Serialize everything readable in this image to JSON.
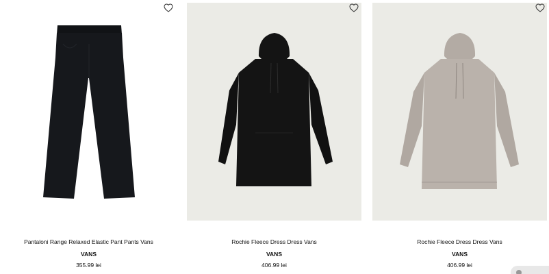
{
  "products": [
    {
      "name": "Pantaloni Range Relaxed Elastic Pant Pants Vans",
      "brand": "VANS",
      "price": "355.99 lei",
      "image_bg": "#ffffff",
      "garment_color": "#16181c"
    },
    {
      "name": "Rochie Fleece Dress Dress Vans",
      "brand": "VANS",
      "price": "406.99 lei",
      "image_bg": "#ebebe6",
      "garment_color": "#141414"
    },
    {
      "name": "Rochie Fleece Dress Dress Vans",
      "brand": "VANS",
      "price": "406.99 lei",
      "image_bg": "#ebebe6",
      "garment_color": "#b9b1aa"
    }
  ],
  "icons": {
    "wishlist": "heart-icon",
    "chat": "chat-icon"
  }
}
